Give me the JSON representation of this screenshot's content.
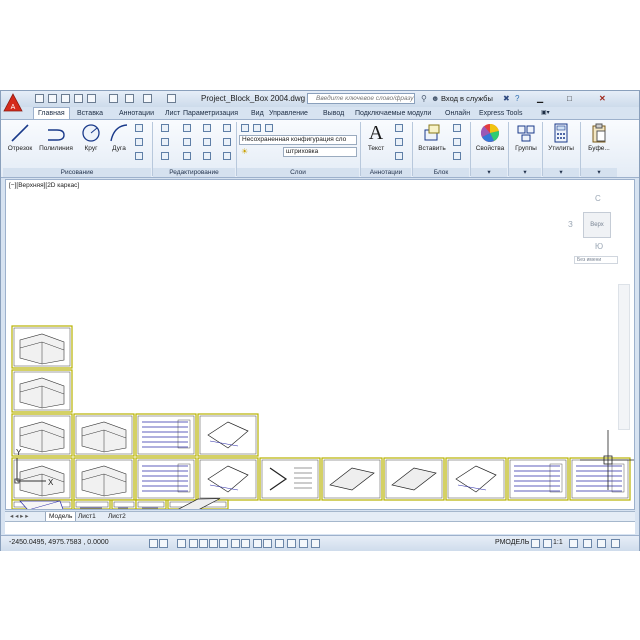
{
  "window": {
    "title": "Project_Block_Box 2004.dwg",
    "search_placeholder": "Введите ключевое слово/фразу",
    "login": "Вход в службы"
  },
  "tabs": [
    "Главная",
    "Вставка",
    "Аннотации",
    "Лист",
    "Параметризация",
    "Вид",
    "Управление",
    "Вывод",
    "Подключаемые модули",
    "Онлайн",
    "Express Tools"
  ],
  "ribbon": {
    "draw": {
      "line": "Отрезок",
      "polyline": "Полилиния",
      "circle": "Круг",
      "arc": "Дуга",
      "footer": "Рисование"
    },
    "modify_footer": "Редактирование",
    "layers": {
      "state": "Несохраненная конфигурация сло",
      "layer": "штриховка",
      "footer": "Слои"
    },
    "annotation": {
      "text": "Текст",
      "footer": "Аннотации"
    },
    "block": {
      "insert": "Вставить",
      "footer": "Блок"
    },
    "properties": "Свойства",
    "groups": "Группы",
    "utilities": "Утилиты",
    "clipboard": "Буфе..."
  },
  "viewport": {
    "label": "[−][Верхняя][2D каркас]",
    "viewcube": {
      "north": "С",
      "south": "Ю",
      "west": "З",
      "center": "Верх",
      "wcs": "Без имени"
    },
    "ucs": {
      "x": "X",
      "y": "Y"
    }
  },
  "layout_tabs": [
    "Модель",
    "Лист1",
    "Лист2"
  ],
  "status": {
    "coords": "-2450.0495, 4975.7583 , 0.0000",
    "model": "РМОДЕЛЬ",
    "scale": "1:1"
  },
  "colors": {
    "accent": "#d42a1c",
    "frame_border": "#b7b200",
    "ribbon": "#e4ecf6",
    "drawing_line": "#2a2aa8"
  }
}
